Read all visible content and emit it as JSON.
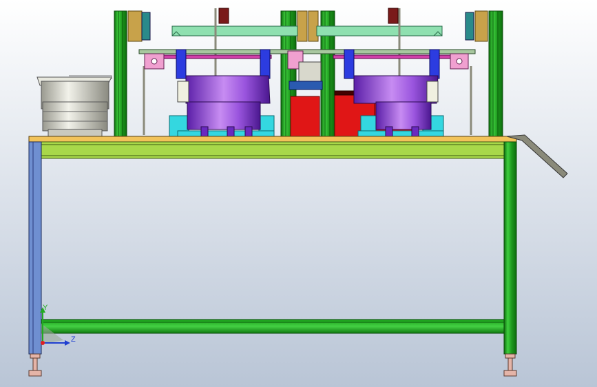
{
  "viewport": {
    "background_top": "#ffffff",
    "background_bottom": "#b9c5d6"
  },
  "triad": {
    "y_label": "Y",
    "z_label": "Z",
    "y_color": "#22aa22",
    "z_color": "#1f3fd0",
    "x_color": "#e02020"
  },
  "colors": {
    "frame_green": "#2ec02e",
    "frame_green_dark": "#0d6d0d",
    "leg_blue": "#6f8fd1",
    "table_top": "#f2c35a",
    "apron": "#a8d84a",
    "bowl_purple": "#8c4ad8",
    "bowl_purple_light": "#c78cf2",
    "red_block": "#e01616",
    "cyan_base": "#34d7e0",
    "mint_beam": "#8fe0b0",
    "magenta_rail": "#d040a8",
    "brass": "#c8a24a",
    "silver": "#d8d8cc",
    "foot_pink": "#e4b4a8"
  }
}
